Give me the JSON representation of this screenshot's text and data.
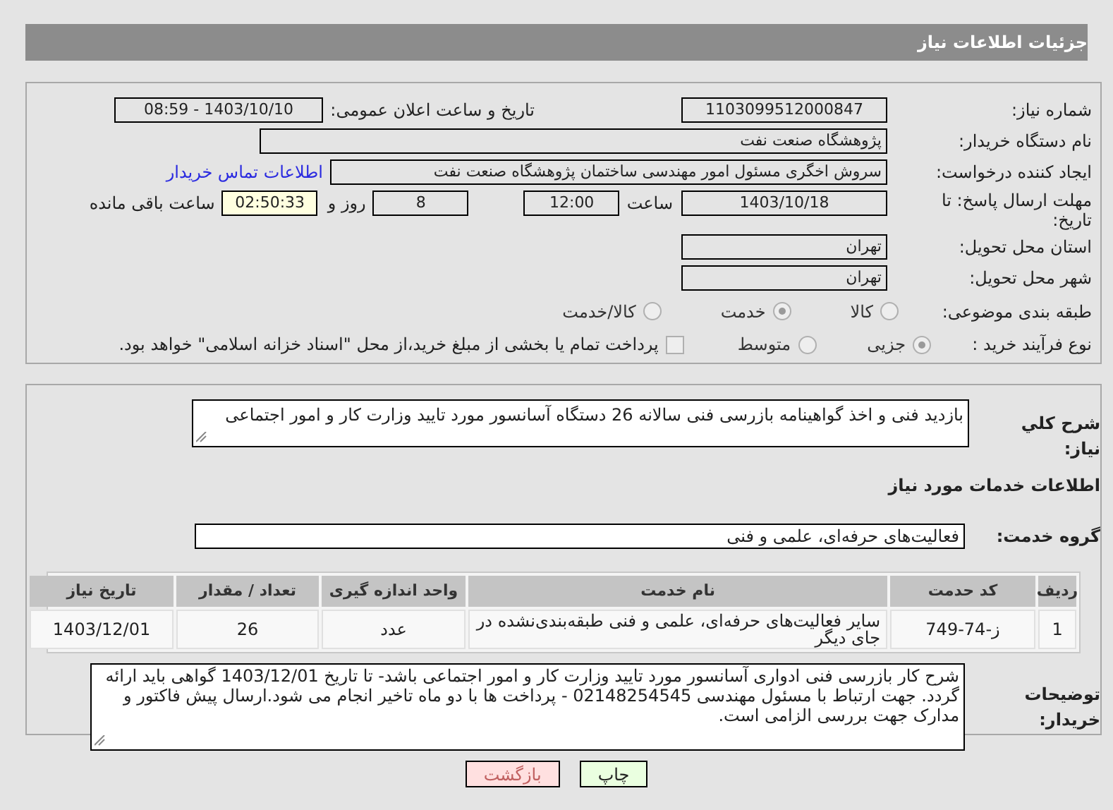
{
  "header": {
    "title": "جزئیات اطلاعات نیاز"
  },
  "fields": {
    "need_number": {
      "label": "شماره نیاز:",
      "value": "1103099512000847"
    },
    "announce": {
      "label": "تاریخ و ساعت اعلان عمومی:",
      "value": "1403/10/10 - 08:59"
    },
    "buyer": {
      "label": "نام دستگاه خریدار:",
      "value": "پژوهشگاه صنعت نفت"
    },
    "creator": {
      "label": "ایجاد کننده درخواست:",
      "value": "سروش اخگری مسئول امور مهندسی ساختمان پژوهشگاه صنعت نفت",
      "link": "اطلاعات تماس خریدار"
    },
    "deadline": {
      "label": "مهلت ارسال پاسخ: تا تاریخ:",
      "date": "1403/10/18",
      "time_label": "ساعت",
      "time": "12:00",
      "days": "8",
      "days_label": "روز و",
      "remaining": "02:50:33",
      "remaining_label": "ساعت باقی مانده"
    },
    "province": {
      "label": "استان محل تحویل:",
      "value": "تهران"
    },
    "city": {
      "label": "شهر محل تحویل:",
      "value": "تهران"
    }
  },
  "category": {
    "label": "طبقه بندی موضوعی:",
    "options": [
      {
        "label": "كالا",
        "selected": false
      },
      {
        "label": "خدمت",
        "selected": true
      },
      {
        "label": "كالا/خدمت",
        "selected": false
      }
    ]
  },
  "process": {
    "label": "نوع فرآیند خرید :",
    "options": [
      {
        "label": "جزیی",
        "selected": true
      },
      {
        "label": "متوسط",
        "selected": false
      }
    ],
    "payment": {
      "label": "پرداخت تمام یا بخشی از مبلغ خرید،از محل \"اسناد خزانه اسلامی\" خواهد بود.",
      "checked": false
    }
  },
  "summary": {
    "label": "شرح كلي نياز:",
    "value": "بازدید فنی و اخذ گواهینامه بازرسی فنی سالانه 26 دستگاه آسانسور مورد تایید وزارت کار و امور اجتماعی"
  },
  "services_heading": "اطلاعات خدمات مورد نیاز",
  "service_group": {
    "label": "گروه خدمت:",
    "value": "فعالیت‌های حرفه‌ای، علمی و فنی"
  },
  "table": {
    "columns": [
      "ردیف",
      "کد حدمت",
      "نام خدمت",
      "واحد اندازه گیری",
      "تعداد / مقدار",
      "تاریخ نیاز"
    ],
    "rows": [
      [
        "1",
        "ز-74-749",
        "سایر فعالیت‌های حرفه‌ای، علمی و فنی طبقه‌بندی‌نشده در جای دیگر",
        "عدد",
        "26",
        "1403/12/01"
      ]
    ]
  },
  "buyer_notes": {
    "label": "توضیحات خریدار:",
    "value": "شرح کار بازرسی فنی ادواری آسانسور مورد تایید وزارت کار و امور اجتماعی باشد- تا تاریخ 1403/12/01 گواهی باید ارائه گردد. جهت ارتباط  با مسئول مهندسی 02148254545 -  پرداخت ها با دو ماه تاخیر انجام می شود.ارسال پیش فاکتور و مدارک جهت بررسی الزامی است."
  },
  "buttons": [
    {
      "label": "چاپ",
      "kind": "print"
    },
    {
      "label": "بازگشت",
      "kind": "back"
    }
  ]
}
